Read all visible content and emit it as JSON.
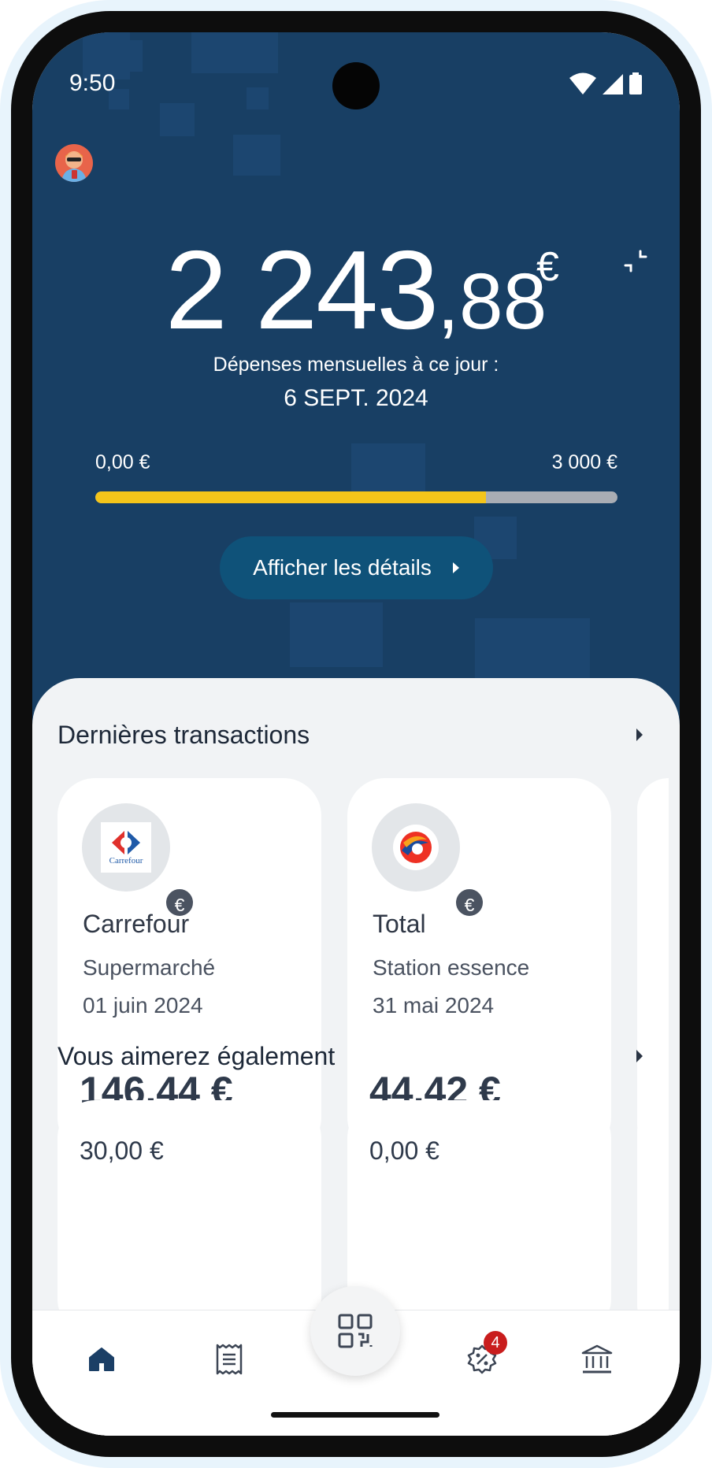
{
  "status_bar": {
    "time": "9:50"
  },
  "summary": {
    "amount_int": "2 243",
    "amount_dec": ",88",
    "currency": "€",
    "label": "Dépenses mensuelles à ce jour :",
    "date": "6 SEPT. 2024",
    "range_min": "0,00 €",
    "range_max": "3 000 €",
    "progress_fraction": 0.748,
    "details_button": "Afficher les détails"
  },
  "transactions": {
    "title": "Dernières transactions",
    "items": [
      {
        "merchant": "Carrefour",
        "logo_text": "Carrefour",
        "category": "Supermarché",
        "date": "01 juin 2024",
        "amount": "146,44 €",
        "badge": "€"
      },
      {
        "merchant": "Total",
        "category": "Station essence",
        "date": "31 mai 2024",
        "amount": "44,42 €",
        "badge": "€"
      }
    ]
  },
  "recommendations": {
    "title": "Vous aimerez également",
    "items": [
      {
        "value": "30,00 €"
      },
      {
        "value": "0,00 €"
      }
    ]
  },
  "nav": {
    "offers_badge": "4",
    "items": [
      "home-icon",
      "receipt-icon",
      "qr-code-icon",
      "discount-icon",
      "bank-icon"
    ]
  },
  "colors": {
    "hero": "#183f64",
    "progress": "#f4c51a",
    "button": "#0f5279",
    "badge": "#c91d1d"
  }
}
